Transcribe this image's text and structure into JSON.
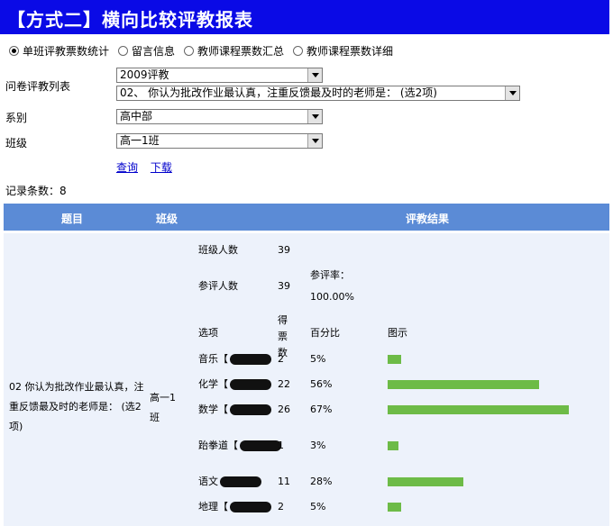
{
  "header": {
    "title": "【方式二】横向比较评教报表"
  },
  "mode_options": [
    {
      "label": "单班评教票数统计",
      "selected": true
    },
    {
      "label": "留言信息",
      "selected": false
    },
    {
      "label": "教师课程票数汇总",
      "selected": false
    },
    {
      "label": "教师课程票数详细",
      "selected": false
    }
  ],
  "form": {
    "survey_label": "问卷评教列表",
    "survey_value": "2009评教",
    "question_value": "02、 你认为批改作业最认真，注重反馈最及时的老师是： (选2项)",
    "dept_label": "系别",
    "dept_value": "高中部",
    "class_label": "班级",
    "class_value": "高一1班",
    "query_link": "查询",
    "download_link": "下载"
  },
  "record_count": "记录条数：8",
  "table": {
    "headers": {
      "topic": "题目",
      "class": "班级",
      "result": "评教结果"
    },
    "topic": "02 你认为批改作业最认真，注重反馈最及时的老师是： (选2项)",
    "class_name": "高一1班",
    "class_size_label": "班级人数",
    "class_size": "39",
    "participants_label": "参评人数",
    "participants": "39",
    "rate_label": "参评率：",
    "rate": "100.00%",
    "col_option": "选项",
    "col_votes": "得票数",
    "col_percent": "百分比",
    "col_chart": "图示",
    "rows": [
      {
        "option": "音乐【",
        "votes": "2",
        "percent": "5%",
        "fraction": 0.05
      },
      {
        "option": "化学【",
        "votes": "22",
        "percent": "56%",
        "fraction": 0.56
      },
      {
        "option": "数学【",
        "votes": "26",
        "percent": "67%",
        "fraction": 0.67
      },
      {
        "option": "跆拳道【",
        "votes": "1",
        "percent": "3%",
        "fraction": 0.03
      },
      {
        "option": "语文",
        "votes": "11",
        "percent": "28%",
        "fraction": 0.28
      },
      {
        "option": "地理【",
        "votes": "2",
        "percent": "5%",
        "fraction": 0.05
      }
    ]
  },
  "colors": {
    "banner": "#0a0ae6",
    "header_row": "#5b8bd6",
    "bar": "#6dbb47",
    "body_row": "#edf2fb"
  }
}
